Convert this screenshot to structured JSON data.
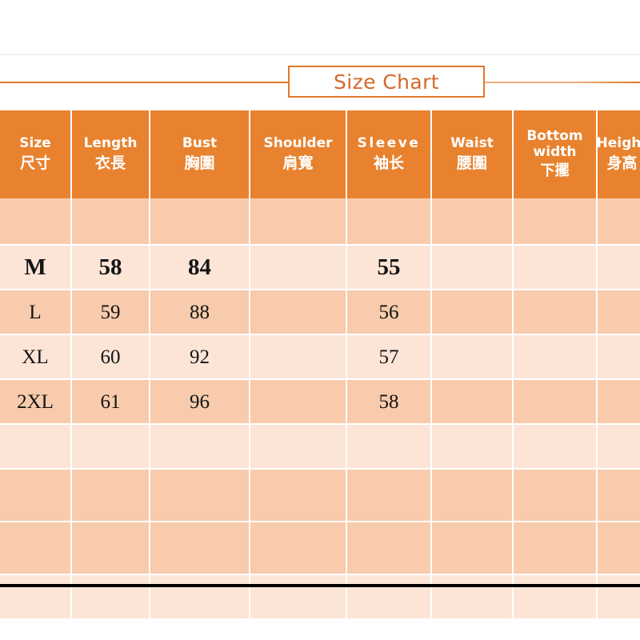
{
  "title": {
    "text": "Size Chart"
  },
  "colors": {
    "header_orange": "#E8822F",
    "row_dark": "#F7CBAB",
    "row_light": "#FCE5D7",
    "title_text": "#D2692A",
    "title_border": "#E2792C",
    "rule_grey": "#DFE5E8",
    "rule_black": "#000000"
  },
  "table": {
    "columns": [
      {
        "en": "Size",
        "cn": "尺寸"
      },
      {
        "en": "Length",
        "cn": "衣長"
      },
      {
        "en": "Bust",
        "cn": "胸圍"
      },
      {
        "en": "Shoulder",
        "cn": "肩寬"
      },
      {
        "en": "Sleeve",
        "cn": "袖长"
      },
      {
        "en": "Waist",
        "cn": "腰圍"
      },
      {
        "en": "Bottom width",
        "cn": "下擺"
      },
      {
        "en": "Height",
        "cn": "身高"
      }
    ],
    "rows": [
      {
        "size": "M",
        "length": "58",
        "bust": "84",
        "shoulder": "",
        "sleeve": "55",
        "waist": "",
        "bottom_width": "",
        "height": ""
      },
      {
        "size": "L",
        "length": "59",
        "bust": "88",
        "shoulder": "",
        "sleeve": "56",
        "waist": "",
        "bottom_width": "",
        "height": ""
      },
      {
        "size": "XL",
        "length": "60",
        "bust": "92",
        "shoulder": "",
        "sleeve": "57",
        "waist": "",
        "bottom_width": "",
        "height": ""
      },
      {
        "size": "2XL",
        "length": "61",
        "bust": "96",
        "shoulder": "",
        "sleeve": "58",
        "waist": "",
        "bottom_width": "",
        "height": ""
      }
    ]
  }
}
